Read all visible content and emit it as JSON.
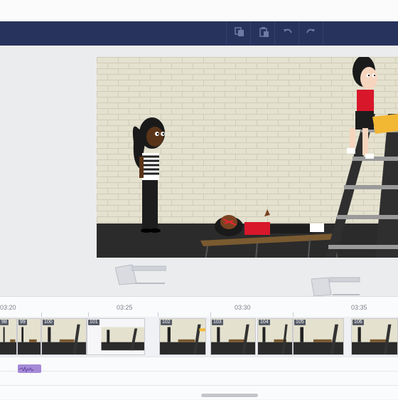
{
  "toolbar": {
    "icons": [
      "copy-icon",
      "paste-icon",
      "undo-icon",
      "redo-icon"
    ]
  },
  "timeline": {
    "time_labels": [
      "03:20",
      "03:25",
      "03:30",
      "03:35"
    ],
    "scenes": [
      {
        "number": "98"
      },
      {
        "number": "99"
      },
      {
        "number": "100"
      },
      {
        "number": "101"
      },
      {
        "number": "102"
      },
      {
        "number": "103"
      },
      {
        "number": "104"
      },
      {
        "number": "105"
      },
      {
        "number": "106"
      }
    ]
  },
  "colors": {
    "toolbar_bg": "#27335d",
    "audio_clip": "#a58ad6",
    "brick_wall": "#e4e1cf",
    "floor": "#2b2b2b"
  }
}
